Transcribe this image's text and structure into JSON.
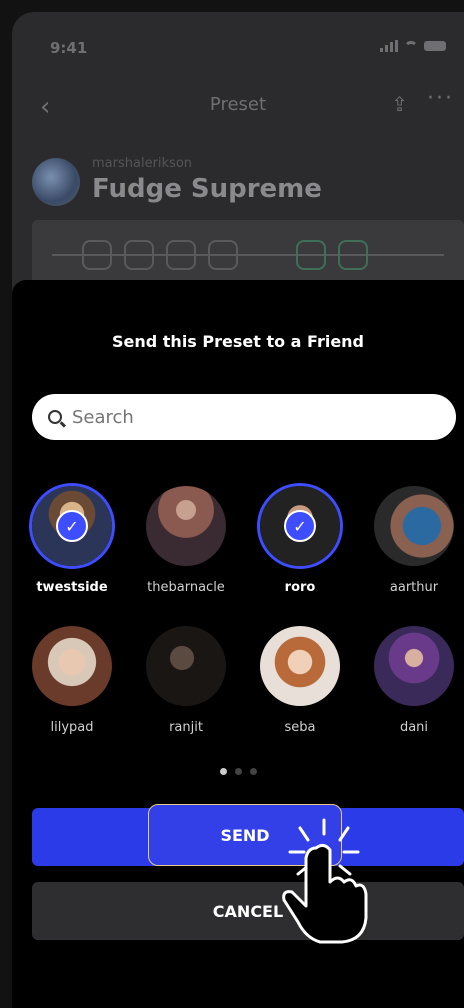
{
  "status": {
    "time": "9:41"
  },
  "nav": {
    "title": "Preset"
  },
  "creator": {
    "handle": "marshalerikson",
    "preset_name": "Fudge Supreme"
  },
  "sheet": {
    "title": "Send this Preset to a Friend",
    "search_placeholder": "Search"
  },
  "friends": [
    {
      "name": "twestside",
      "selected": true
    },
    {
      "name": "thebarnacle",
      "selected": false
    },
    {
      "name": "roro",
      "selected": true
    },
    {
      "name": "aarthur",
      "selected": false
    },
    {
      "name": "lilypad",
      "selected": false
    },
    {
      "name": "ranjit",
      "selected": false
    },
    {
      "name": "seba",
      "selected": false
    },
    {
      "name": "dani",
      "selected": false
    }
  ],
  "pagination": {
    "pages": 3,
    "current": 1
  },
  "buttons": {
    "send": "SEND",
    "cancel": "CANCEL"
  },
  "colors": {
    "accent": "#3d4dff",
    "sheet": "#000000",
    "background": "#2b2b2d"
  }
}
